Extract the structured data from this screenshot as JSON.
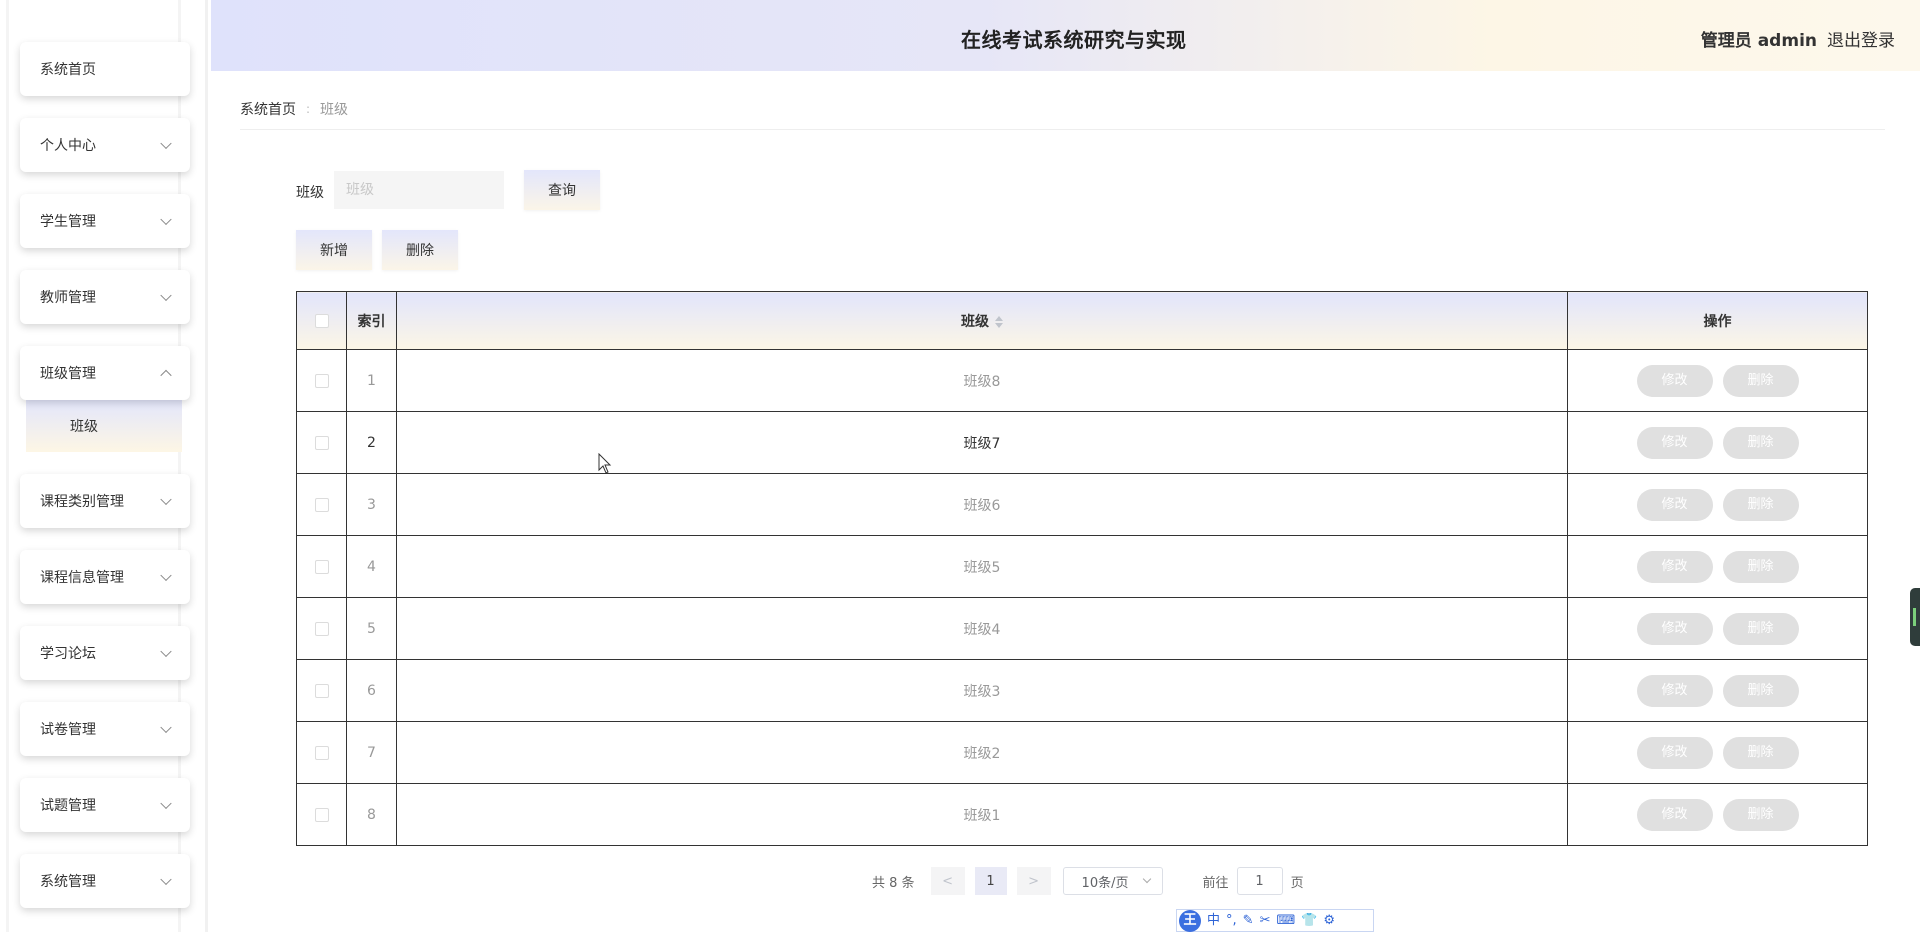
{
  "header": {
    "title": "在线考试系统研究与实现",
    "role": "管理员 admin",
    "logout": "退出登录"
  },
  "sidebar": {
    "items": [
      {
        "label": "系统首页"
      },
      {
        "label": "个人中心"
      },
      {
        "label": "学生管理"
      },
      {
        "label": "教师管理"
      },
      {
        "label": "班级管理"
      },
      {
        "label": "课程类别管理"
      },
      {
        "label": "课程信息管理"
      },
      {
        "label": "学习论坛"
      },
      {
        "label": "试卷管理"
      },
      {
        "label": "试题管理"
      },
      {
        "label": "系统管理"
      }
    ],
    "sub_item": "班级"
  },
  "breadcrumb": {
    "home": "系统首页",
    "separator": ":",
    "current": "班级"
  },
  "search": {
    "label": "班级",
    "placeholder": "班级",
    "value": "",
    "query_button": "查询"
  },
  "actions": {
    "add": "新增",
    "delete": "删除"
  },
  "table": {
    "columns": {
      "index": "索引",
      "class": "班级",
      "ops": "操作"
    },
    "edit_label": "修改",
    "delete_label": "删除",
    "rows": [
      {
        "index": "1",
        "class": "班级8"
      },
      {
        "index": "2",
        "class": "班级7"
      },
      {
        "index": "3",
        "class": "班级6"
      },
      {
        "index": "4",
        "class": "班级5"
      },
      {
        "index": "5",
        "class": "班级4"
      },
      {
        "index": "6",
        "class": "班级3"
      },
      {
        "index": "7",
        "class": "班级2"
      },
      {
        "index": "8",
        "class": "班级1"
      }
    ]
  },
  "pagination": {
    "total": "共 8 条",
    "prev": "<",
    "current_page": "1",
    "next": ">",
    "page_size": "10条/页",
    "goto_prefix": "前往",
    "goto_value": "1",
    "goto_suffix": "页"
  },
  "ime": {
    "logo": "王",
    "mode": "中",
    "punct": "°,",
    "icons": [
      "✎",
      "✂",
      "⌨",
      "👕",
      "⚙"
    ]
  },
  "colors": {
    "header_gradient_start": "#dfe2fb",
    "header_gradient_end": "#fdf6e6",
    "button_gradient_start": "#e3e6fb",
    "button_gradient_end": "#fbf5e8",
    "op_button": "#e0e0e0"
  }
}
